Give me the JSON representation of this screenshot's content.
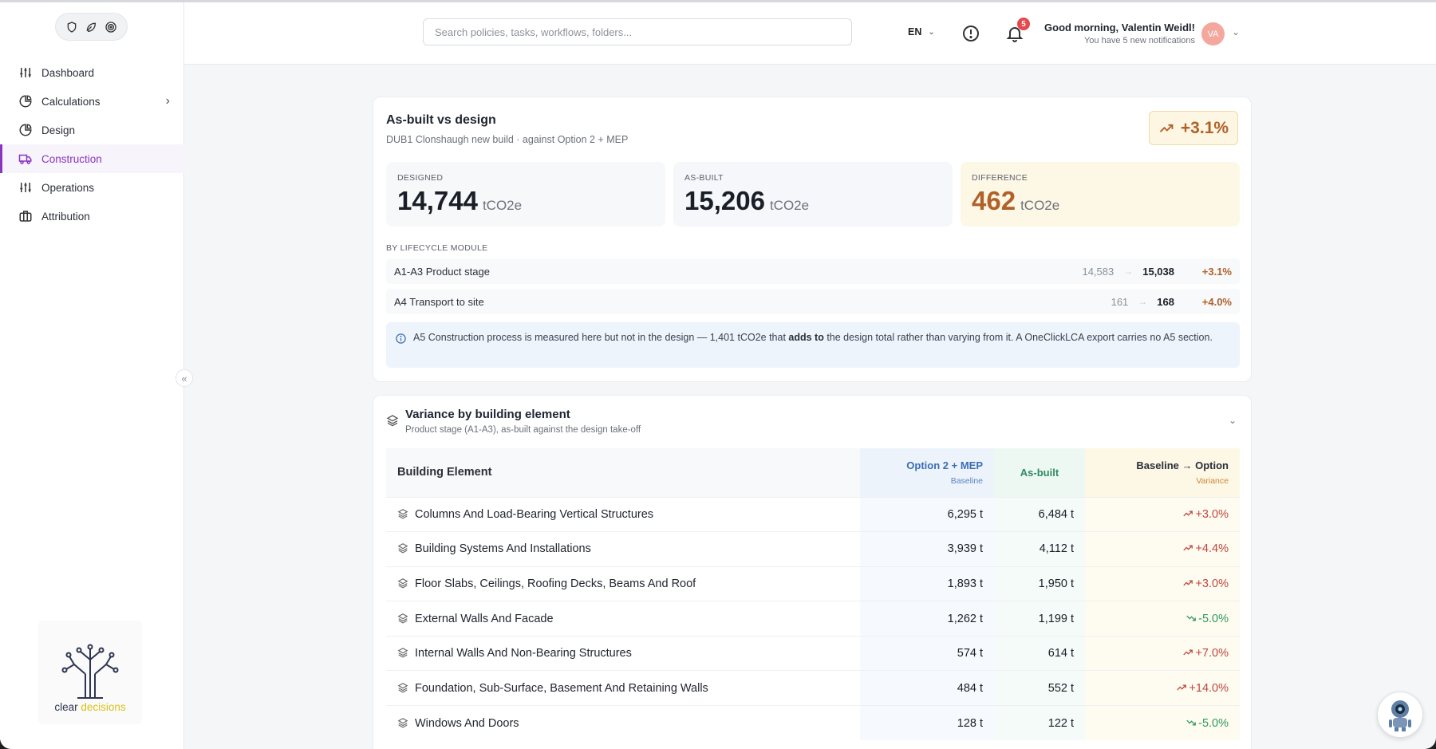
{
  "sidebar": {
    "items": [
      {
        "label": "Dashboard",
        "icon": "sliders-icon"
      },
      {
        "label": "Calculations",
        "icon": "pie-chart-icon"
      },
      {
        "label": "Design",
        "icon": "pie-chart-icon"
      },
      {
        "label": "Construction",
        "icon": "truck-icon"
      },
      {
        "label": "Operations",
        "icon": "sliders-icon"
      },
      {
        "label": "Attribution",
        "icon": "briefcase-icon"
      }
    ],
    "collapse_glyph": "«",
    "brand": {
      "word1": "clear",
      "word2": "decisions"
    }
  },
  "header": {
    "search_placeholder": "Search policies, tasks, workflows, folders...",
    "language": "EN",
    "notifications_count": "5",
    "greeting": "Good morning, Valentin Weidl!",
    "greeting_sub": "You have 5 new notifications",
    "avatar_initials": "VA"
  },
  "summary": {
    "title": "As-built vs design",
    "subtitle": "DUB1 Clonshaugh new build · against Option 2 + MEP",
    "badge": "+3.1%",
    "stats": [
      {
        "label": "DESIGNED",
        "value": "14,744",
        "unit": "tCO2e"
      },
      {
        "label": "AS-BUILT",
        "value": "15,206",
        "unit": "tCO2e"
      },
      {
        "label": "DIFFERENCE",
        "value": "462",
        "unit": "tCO2e"
      }
    ],
    "modules_heading": "BY LIFECYCLE MODULE",
    "modules": [
      {
        "name": "A1-A3 Product stage",
        "from": "14,583",
        "to": "15,038",
        "pct": "+3.1%"
      },
      {
        "name": "A4 Transport to site",
        "from": "161",
        "to": "168",
        "pct": "+4.0%"
      }
    ],
    "arrow_glyph": "→",
    "note_part1": "A5 Construction process is measured here but not in the design — 1,401 tCO2e that ",
    "note_bold": "adds to",
    "note_part2": " the design total rather than varying from it. A OneClickLCA export carries no A5 section."
  },
  "variance": {
    "title": "Variance by building element",
    "subtitle": "Product stage (A1-A3), as-built against the design take-off",
    "columns": {
      "element": "Building Element",
      "baseline_main": "Option 2 + MEP",
      "baseline_sub": "Baseline",
      "asbuilt": "As-built",
      "variance_main": "Baseline → Option",
      "variance_sub": "Variance"
    },
    "rows": [
      {
        "name": "Columns And Load-Bearing Vertical Structures",
        "baseline": "6,295 t",
        "asbuilt": "6,484 t",
        "variance": "+3.0%",
        "dir": "up"
      },
      {
        "name": "Building Systems And Installations",
        "baseline": "3,939 t",
        "asbuilt": "4,112 t",
        "variance": "+4.4%",
        "dir": "up"
      },
      {
        "name": "Floor Slabs, Ceilings, Roofing Decks, Beams And Roof",
        "baseline": "1,893 t",
        "asbuilt": "1,950 t",
        "variance": "+3.0%",
        "dir": "up"
      },
      {
        "name": "External Walls And Facade",
        "baseline": "1,262 t",
        "asbuilt": "1,199 t",
        "variance": "-5.0%",
        "dir": "down"
      },
      {
        "name": "Internal Walls And Non-Bearing Structures",
        "baseline": "574 t",
        "asbuilt": "614 t",
        "variance": "+7.0%",
        "dir": "up"
      },
      {
        "name": "Foundation, Sub-Surface, Basement And Retaining Walls",
        "baseline": "484 t",
        "asbuilt": "552 t",
        "variance": "+14.0%",
        "dir": "up"
      },
      {
        "name": "Windows And Doors",
        "baseline": "128 t",
        "asbuilt": "122 t",
        "variance": "-5.0%",
        "dir": "down"
      }
    ]
  },
  "colors": {
    "accent": "#8a34c0",
    "increase": "#c0463b",
    "decrease": "#2e9a5c",
    "difference": "#b0612a"
  }
}
